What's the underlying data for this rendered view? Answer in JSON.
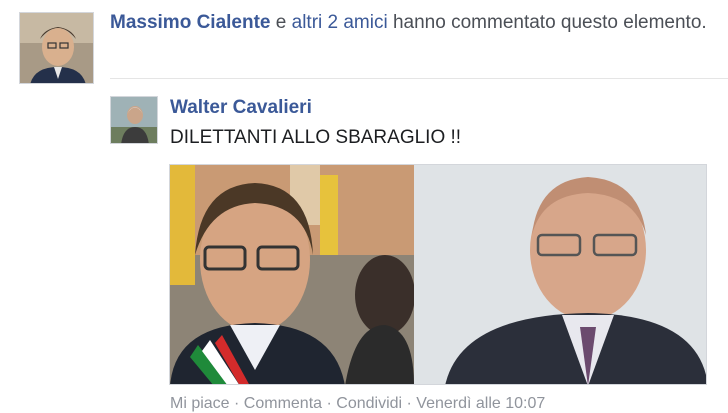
{
  "notification": {
    "actor_name": "Massimo Cialente",
    "connector": " e ",
    "others_link": "altri 2 amici",
    "suffix": " hanno commentato questo elemento."
  },
  "post": {
    "author": "Walter Cavalieri",
    "text": "DILETTANTI ALLO SBARAGLIO !!",
    "meta_partial": "Mi piace · Commenta · Condividi · Venerdì alle 10:07"
  },
  "colors": {
    "link": "#3b5998",
    "meta": "#90949c"
  }
}
